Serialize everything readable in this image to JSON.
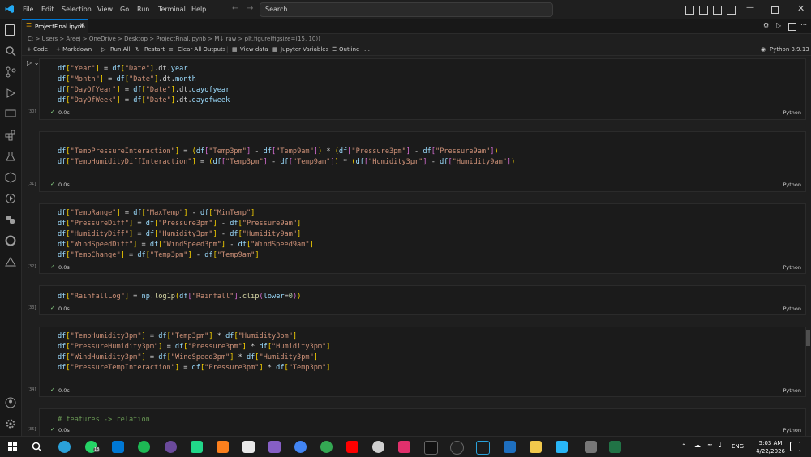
{
  "menu": [
    "File",
    "Edit",
    "Selection",
    "View",
    "Go",
    "Run",
    "Terminal",
    "Help"
  ],
  "search": {
    "label": "Search"
  },
  "tab": {
    "title": "ProjectFinal.ipynb"
  },
  "breadcrumb": "C: > Users > Areej > OneDrive > Desktop > ProjectFinal.ipynb > M↓ raw > plt.figure(figsize=(15, 10))",
  "toolbar": {
    "code": "+ Code",
    "markdown": "+ Markdown",
    "run_all": "Run All",
    "restart": "Restart",
    "clear": "Clear All Outputs",
    "view_data": "View data",
    "variables": "Jupyter Variables",
    "outline": "Outline",
    "more": "…",
    "kernel": "Python 3.9.13"
  },
  "cells": [
    {
      "label": "[30]",
      "time": "0.0s",
      "lang": "Python"
    },
    {
      "label": "[31]",
      "time": "0.0s",
      "lang": "Python"
    },
    {
      "label": "[32]",
      "time": "0.0s",
      "lang": "Python"
    },
    {
      "label": "[33]",
      "time": "0.0s",
      "lang": "Python"
    },
    {
      "label": "[34]",
      "time": "0.0s",
      "lang": "Python"
    },
    {
      "label": "[35]",
      "time": "0.0s",
      "lang": "Python"
    }
  ],
  "comment": "# features -> relation",
  "taskbar": {
    "lang": "ENG",
    "time": "5:03 AM",
    "date": "4/22/2026",
    "badge": "18"
  },
  "colors": {
    "accent": "#0078d4",
    "editor_bg": "#1f1f1f",
    "string": "#ce9178",
    "variable": "#9cdcfe"
  }
}
